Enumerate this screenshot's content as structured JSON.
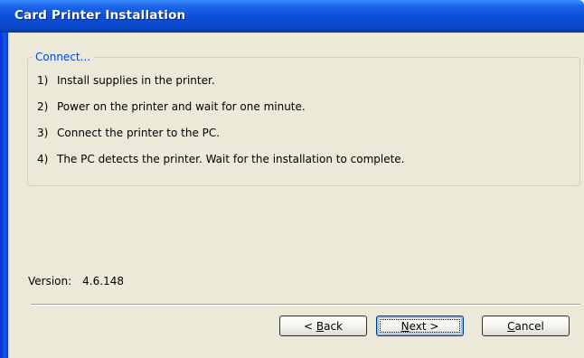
{
  "window": {
    "title": "Card Printer Installation"
  },
  "group": {
    "legend": "Connect..."
  },
  "steps": [
    {
      "num": "1)",
      "text": "Install supplies in the printer."
    },
    {
      "num": "2)",
      "text": "Power on the printer and wait for one minute."
    },
    {
      "num": "3)",
      "text": "Connect the printer to the PC."
    },
    {
      "num": "4)",
      "text": "The PC detects the printer. Wait for the installation to complete."
    }
  ],
  "version": {
    "label": "Version:",
    "value": "4.6.148"
  },
  "buttons": {
    "back": {
      "prefix": "< ",
      "accel": "B",
      "rest": "ack"
    },
    "next": {
      "accel": "N",
      "rest": "ext",
      "suffix": " >"
    },
    "cancel": {
      "accel": "C",
      "rest": "ancel"
    }
  },
  "colors": {
    "title_bar": "#0A4ED8",
    "group_legend": "#0046D5",
    "dialog_background": "#ECE9D8"
  }
}
